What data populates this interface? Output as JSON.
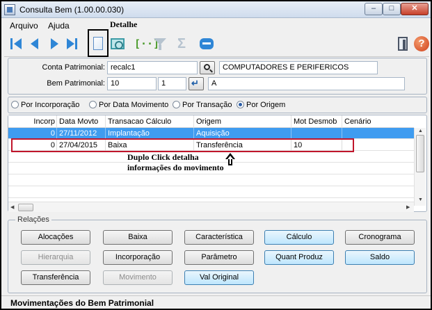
{
  "window": {
    "title": "Consulta Bem (1.00.00.030)",
    "minimize": "–",
    "maximize": "□",
    "close": "✕"
  },
  "menu": [
    {
      "label": "Arquivo"
    },
    {
      "label": "Ajuda"
    }
  ],
  "annotations": {
    "detalhe": "Detalhe",
    "duplo_line1": "Duplo Click detalha",
    "duplo_line2": "informações do movimento"
  },
  "form": {
    "conta_label": "Conta Patrimonial:",
    "conta_value": "recalc1",
    "conta_desc": "COMPUTADORES E PERIFERICOS",
    "bem_label": "Bem Patrimonial:",
    "bem_value": "10",
    "bem_seq": "1",
    "bem_desc": "A"
  },
  "order": [
    {
      "label": "Por Incorporação",
      "selected": false
    },
    {
      "label": "Por Data Movimento",
      "selected": false
    },
    {
      "label": "Por Transação",
      "selected": false
    },
    {
      "label": "Por Origem",
      "selected": true
    }
  ],
  "grid": {
    "columns": [
      "Incorp",
      "Data Movto",
      "Transacao Cálculo",
      "Origem",
      "Mot Desmob",
      "Cenário"
    ],
    "rows": [
      {
        "incorp": "0",
        "data": "27/11/2012",
        "transacao": "Implantação",
        "origem": "Aquisição",
        "mot": "",
        "cenario": "",
        "selected": true
      },
      {
        "incorp": "0",
        "data": "27/04/2015",
        "transacao": "Baixa",
        "origem": "Transferência",
        "mot": "10",
        "cenario": "",
        "selected": false
      }
    ]
  },
  "relations": {
    "title": "Relações",
    "buttons": [
      [
        "Alocações",
        "Baixa",
        "Característica",
        "Cálculo",
        "Cronograma"
      ],
      [
        "Hierarquia",
        "Incorporação",
        "Parâmetro",
        "Quant Produz",
        "Saldo"
      ],
      [
        "Transferência",
        "Movimento",
        "Val Original"
      ]
    ]
  },
  "status": {
    "text": "Movimentações do Bem Patrimonial"
  },
  "colors": {
    "selection": "#3f9cf0",
    "highlight_border": "#c0152b",
    "accent_button": "#bee6fd"
  }
}
